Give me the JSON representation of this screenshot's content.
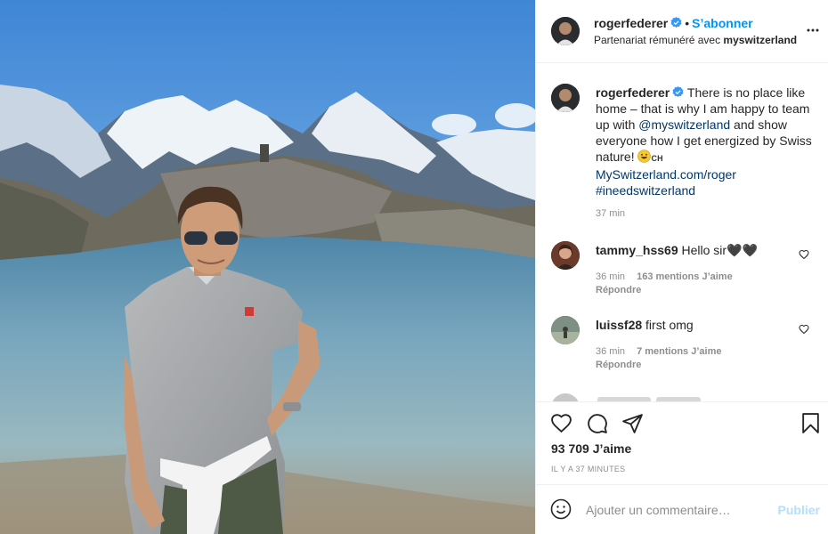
{
  "post": {
    "author": {
      "username": "rogerfederer",
      "verified": true,
      "follow_label": "Sʼabonner",
      "partnership_prefix": "Partenariat rémunéré avec",
      "partner": "myswitzerland"
    },
    "caption": {
      "username": "rogerfederer",
      "text_1": "There is no place like home – that is why I am happy to team up with",
      "mention": "@myswitzerland",
      "text_2": "and show everyone how I get energized by Swiss nature!",
      "flag": "CH",
      "url": "MySwitzerland.com/roger",
      "hashtag": "#ineedswitzerland",
      "time": "37 min"
    },
    "comments": [
      {
        "username": "tammy_hss69",
        "text": "Hello sir🖤🖤",
        "time": "36 min",
        "likes": "163 mentions J’aime",
        "reply": "Répondre"
      },
      {
        "username": "luissf28",
        "text": "first omg",
        "time": "36 min",
        "likes": "7 mentions J’aime",
        "reply": "Répondre"
      }
    ],
    "likes": "93 709 J’aime",
    "posted": "IL Y A 37 MINUTES",
    "comment_input": {
      "placeholder": "Ajouter un commentaire…"
    },
    "publish_label": "Publier",
    "colors": {
      "accent": "#0095f6",
      "publish_disabled": "#b2dffc",
      "text": "#262626",
      "muted": "#8e8e8e",
      "link": "#00376b"
    },
    "icons": [
      "verified-badge-icon",
      "more-options-icon",
      "heart-icon",
      "comment-icon",
      "share-icon",
      "save-icon",
      "emoji-icon"
    ]
  }
}
